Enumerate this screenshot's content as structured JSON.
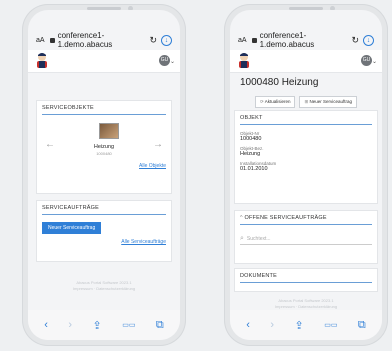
{
  "browser": {
    "aa": "aA",
    "url": "conference1-1.demo.abacus",
    "reload": "↻",
    "download": "↓"
  },
  "user": {
    "initials": "GU",
    "caret": "⌄"
  },
  "left": {
    "objects_title": "SERVICEOBJEKTE",
    "object_name": "Heizung",
    "object_number": "1000480",
    "prev_arrow": "←",
    "next_arrow": "→",
    "all_objects": "Alle Objekte",
    "orders_title": "SERVICEAUFTRÄGE",
    "new_order": "Neuer Serviceauftrag",
    "all_orders": "Alle Serviceaufträge",
    "footer_line1": "Abacus Portal Software 2023.1",
    "footer_line2": "Impressum · Datenschutzerklärung"
  },
  "right": {
    "title": "1000480 Heizung",
    "refresh": "Aktualisieren",
    "new_order": "Neuer Serviceauftrag",
    "object_section": "OBJEKT",
    "fields": [
      {
        "label": "Objekt-Nr",
        "value": "1000480"
      },
      {
        "label": "Objekt-Bez.",
        "value": "Heizung"
      },
      {
        "label": "Installationsdatum",
        "value": "01.01.2010"
      }
    ],
    "open_orders": "OFFENE SERVICEAUFTRÄGE",
    "search_placeholder": "Suchtext...",
    "documents": "DOKUMENTE",
    "footer_line1": "Abacus Portal Software 2023.1",
    "footer_line2": "Impressum · Datenschutzerklärung"
  },
  "toolbar": {
    "back": "‹",
    "forward": "›",
    "share": "⇪",
    "bookmarks": "▭▭",
    "tabs": "⧉"
  },
  "colors": {
    "accent": "#2f7fd7",
    "divider": "#6a9ed6"
  }
}
